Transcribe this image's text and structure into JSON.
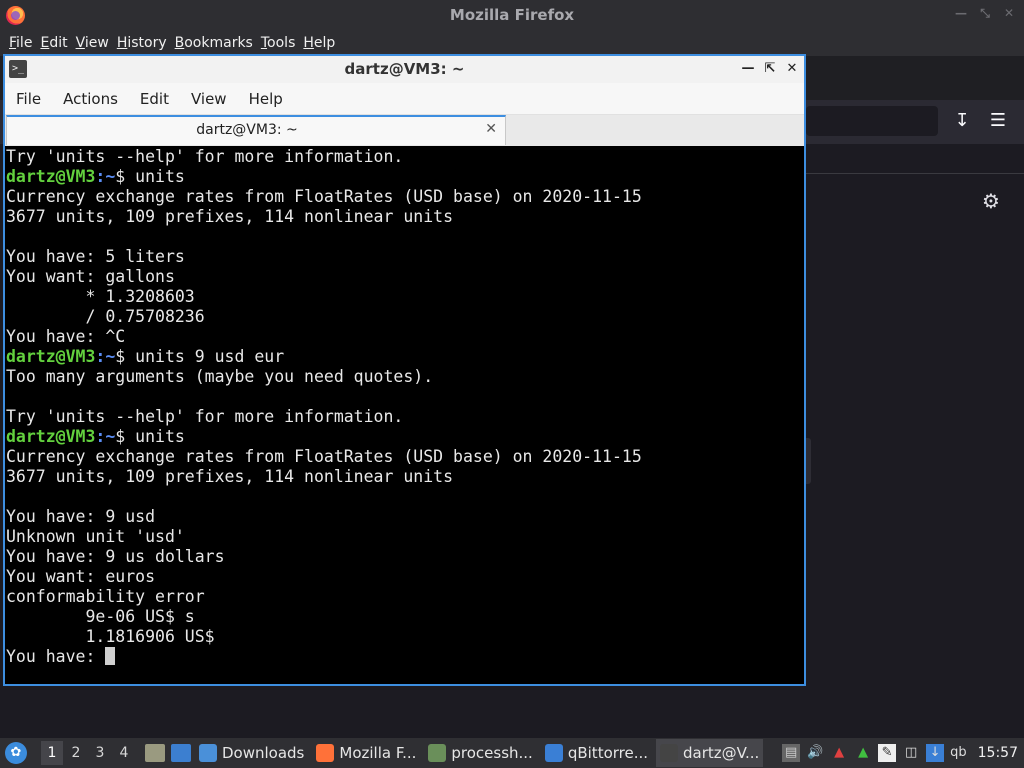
{
  "firefox": {
    "window_title": "Mozilla Firefox",
    "menu": [
      "File",
      "Edit",
      "View",
      "History",
      "Bookmarks",
      "Tools",
      "Help"
    ],
    "download_icon": "download-icon",
    "menu_icon": "hamburger-menu-icon",
    "settings_icon": "gear-icon"
  },
  "terminal": {
    "window_title": "dartz@VM3: ~",
    "menu": [
      "File",
      "Actions",
      "Edit",
      "View",
      "Help"
    ],
    "tab_label": "dartz@VM3: ~",
    "lines": [
      {
        "kind": "out",
        "text": "Try 'units --help' for more information."
      },
      {
        "kind": "prompt",
        "user": "dartz@VM3",
        "path": ":~",
        "cmd": "$ units"
      },
      {
        "kind": "out",
        "text": "Currency exchange rates from FloatRates (USD base) on 2020-11-15"
      },
      {
        "kind": "out",
        "text": "3677 units, 109 prefixes, 114 nonlinear units"
      },
      {
        "kind": "out",
        "text": ""
      },
      {
        "kind": "out",
        "text": "You have: 5 liters"
      },
      {
        "kind": "out",
        "text": "You want: gallons"
      },
      {
        "kind": "out",
        "text": "        * 1.3208603"
      },
      {
        "kind": "out",
        "text": "        / 0.75708236"
      },
      {
        "kind": "out",
        "text": "You have: ^C"
      },
      {
        "kind": "prompt",
        "user": "dartz@VM3",
        "path": ":~",
        "cmd": "$ units 9 usd eur"
      },
      {
        "kind": "out",
        "text": "Too many arguments (maybe you need quotes)."
      },
      {
        "kind": "out",
        "text": ""
      },
      {
        "kind": "out",
        "text": "Try 'units --help' for more information."
      },
      {
        "kind": "prompt",
        "user": "dartz@VM3",
        "path": ":~",
        "cmd": "$ units"
      },
      {
        "kind": "out",
        "text": "Currency exchange rates from FloatRates (USD base) on 2020-11-15"
      },
      {
        "kind": "out",
        "text": "3677 units, 109 prefixes, 114 nonlinear units"
      },
      {
        "kind": "out",
        "text": ""
      },
      {
        "kind": "out",
        "text": "You have: 9 usd"
      },
      {
        "kind": "out",
        "text": "Unknown unit 'usd'"
      },
      {
        "kind": "out",
        "text": "You have: 9 us dollars"
      },
      {
        "kind": "out",
        "text": "You want: euros"
      },
      {
        "kind": "out",
        "text": "conformability error"
      },
      {
        "kind": "out",
        "text": "        9e-06 US$ s"
      },
      {
        "kind": "out",
        "text": "        1.1816906 US$"
      }
    ],
    "current_prompt": "You have: "
  },
  "taskbar": {
    "workspaces": [
      "1",
      "2",
      "3",
      "4"
    ],
    "active_workspace": "1",
    "tasks": [
      {
        "label": "Downloads",
        "icon": "folder-icon",
        "color": "#4a90d9"
      },
      {
        "label": "Mozilla F...",
        "icon": "firefox-icon",
        "color": "#ff7139"
      },
      {
        "label": "processh...",
        "icon": "monitor-icon",
        "color": "#6a8f5a"
      },
      {
        "label": "qBittorre...",
        "icon": "qbittorrent-icon",
        "color": "#3a7fd5"
      },
      {
        "label": "dartz@V...",
        "icon": "terminal-icon",
        "color": "#444444",
        "active": true
      }
    ],
    "tray_text": "qb",
    "clock": "15:57"
  }
}
